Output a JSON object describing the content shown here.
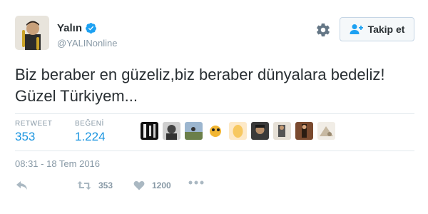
{
  "user": {
    "display_name": "Yalın",
    "handle": "@YALINonline",
    "verified": true
  },
  "header": {
    "follow_label": "Takip et"
  },
  "tweet": {
    "text": "Biz beraber en güzeliz,biz beraber dünyalara bedeliz! Güzel Türkiyem..."
  },
  "stats": {
    "retweets_label": "RETWEET",
    "retweets_value": "353",
    "likes_label": "BEĞENİ",
    "likes_value": "1.224"
  },
  "likers": [
    {
      "name": "liker-1"
    },
    {
      "name": "liker-2"
    },
    {
      "name": "liker-3"
    },
    {
      "name": "liker-4"
    },
    {
      "name": "liker-5"
    },
    {
      "name": "liker-6"
    },
    {
      "name": "liker-7"
    },
    {
      "name": "liker-8"
    },
    {
      "name": "liker-9"
    }
  ],
  "timestamp": "08:31 - 18 Tem 2016",
  "actions": {
    "retweet_count": "353",
    "like_count": "1200"
  },
  "colors": {
    "accent": "#1b95e0",
    "muted": "#8899a6",
    "verified": "#1da1f2"
  }
}
